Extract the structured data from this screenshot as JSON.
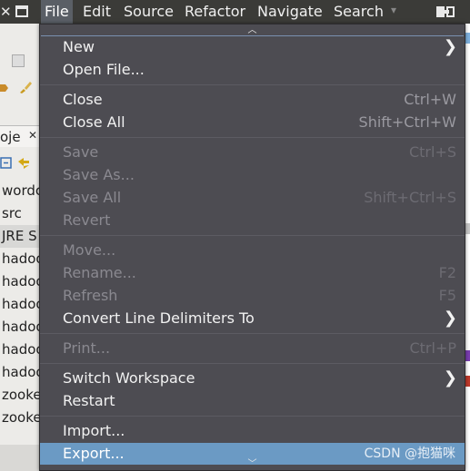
{
  "menubar": {
    "close_glyph": "✕",
    "menus": [
      "File",
      "Edit",
      "Source",
      "Refactor",
      "Navigate",
      "Search"
    ],
    "more_glyph": "▾"
  },
  "background": {
    "view_tab_label": "oje",
    "view_tab_close": "✕",
    "tree_items": [
      "wordcc",
      "src",
      "JRE S",
      "hadoo",
      "hadoo",
      "hadoo",
      "hadoo",
      "hadoo",
      "hadoo",
      "zooke",
      "zooke"
    ],
    "tree_selected_index": 2
  },
  "file_menu": {
    "scroll_up_glyph": "︿",
    "scroll_down_glyph": "﹀",
    "items": [
      {
        "label": "New",
        "submenu": true,
        "enabled": true
      },
      {
        "label": "Open File...",
        "enabled": true
      },
      {
        "label": "Close",
        "shortcut": "Ctrl+W",
        "enabled": true
      },
      {
        "label": "Close All",
        "shortcut": "Shift+Ctrl+W",
        "enabled": true
      },
      {
        "label": "Save",
        "shortcut": "Ctrl+S",
        "enabled": false
      },
      {
        "label": "Save As...",
        "enabled": false
      },
      {
        "label": "Save All",
        "shortcut": "Shift+Ctrl+S",
        "enabled": false
      },
      {
        "label": "Revert",
        "enabled": false
      },
      {
        "label": "Move...",
        "enabled": false
      },
      {
        "label": "Rename...",
        "shortcut": "F2",
        "enabled": false
      },
      {
        "label": "Refresh",
        "shortcut": "F5",
        "enabled": false
      },
      {
        "label": "Convert Line Delimiters To",
        "submenu": true,
        "enabled": true
      },
      {
        "label": "Print...",
        "shortcut": "Ctrl+P",
        "enabled": false
      },
      {
        "label": "Switch Workspace",
        "submenu": true,
        "enabled": true
      },
      {
        "label": "Restart",
        "enabled": true
      },
      {
        "label": "Import...",
        "enabled": true
      },
      {
        "label": "Export...",
        "enabled": true,
        "highlighted": true
      }
    ],
    "submenu_glyph": "❯",
    "watermark": "CSDN @抱猫咪"
  },
  "colors": {
    "menubar_bg": "#3b3b38",
    "menu_bg": "#4d4c52",
    "highlight": "#6b9ac4",
    "disabled_text": "#8a8990"
  }
}
